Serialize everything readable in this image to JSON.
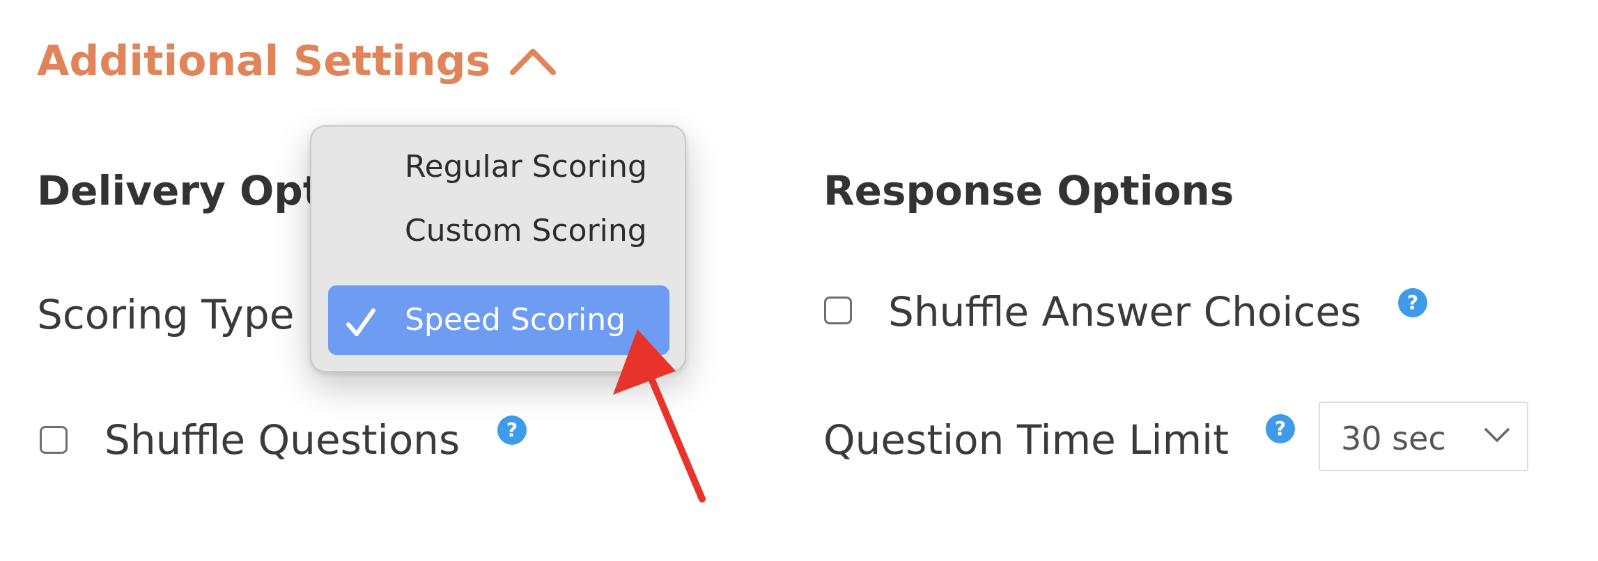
{
  "section": {
    "title": "Additional Settings",
    "expanded_icon": "chevron-up-icon"
  },
  "delivery": {
    "heading": "Delivery Opt",
    "scoring_type_label": "Scoring Type",
    "shuffle_questions_label": "Shuffle Questions"
  },
  "response": {
    "heading": "Response Options",
    "shuffle_answers_label": "Shuffle Answer Choices",
    "time_limit_label": "Question Time Limit",
    "time_limit_value": "30 sec"
  },
  "help_icon_glyph": "?",
  "scoring_menu": {
    "items": [
      {
        "label": "Regular Scoring",
        "selected": false
      },
      {
        "label": "Custom Scoring",
        "selected": false
      },
      {
        "label": "Speed Scoring",
        "selected": true
      }
    ]
  },
  "colors": {
    "accent": "#e0855a",
    "help_icon": "#3d9be9",
    "menu_highlight": "#6f9cf3",
    "annotation_arrow": "#e8332a"
  },
  "checkboxes": {
    "shuffle_questions_checked": false,
    "shuffle_answers_checked": false
  }
}
